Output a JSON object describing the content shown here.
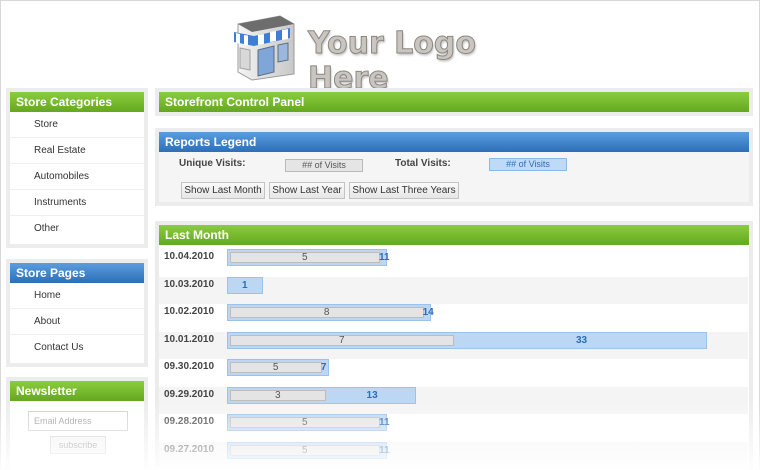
{
  "header": {
    "logo_text": "Your Logo Here"
  },
  "sidebar": {
    "categories": {
      "title": "Store Categories",
      "items": [
        "Store",
        "Real Estate",
        "Automobiles",
        "Instruments",
        "Other"
      ]
    },
    "pages": {
      "title": "Store Pages",
      "items": [
        "Home",
        "About",
        "Contact Us"
      ]
    },
    "newsletter": {
      "title": "Newsletter",
      "email_placeholder": "Email Address",
      "subscribe_label": "subscribe"
    }
  },
  "main": {
    "title": "Storefront Control Panel",
    "legend": {
      "title": "Reports Legend",
      "unique_label": "Unique Visits:",
      "unique_chip": "## of Visits",
      "total_label": "Total Visits:",
      "total_chip": "## of Visits",
      "buttons": [
        "Show Last Month",
        "Show Last Year",
        "Show Last Three Years"
      ]
    },
    "report": {
      "title": "Last Month",
      "max_total": 33,
      "rows": [
        {
          "date": "10.04.2010",
          "unique": 5,
          "total": 11
        },
        {
          "date": "10.03.2010",
          "unique": 1,
          "total": 1
        },
        {
          "date": "10.02.2010",
          "unique": 8,
          "total": 14
        },
        {
          "date": "10.01.2010",
          "unique": 7,
          "total": 33
        },
        {
          "date": "09.30.2010",
          "unique": 5,
          "total": 7
        },
        {
          "date": "09.29.2010",
          "unique": 3,
          "total": 13
        },
        {
          "date": "09.28.2010",
          "unique": 5,
          "total": 11
        },
        {
          "date": "09.27.2010",
          "unique": 5,
          "total": 11
        }
      ]
    }
  },
  "colors": {
    "green": "#6fb52a",
    "blue": "#2f72bb",
    "total_bar": "#bcd7f4",
    "unique_bar": "#e4e4e4"
  }
}
